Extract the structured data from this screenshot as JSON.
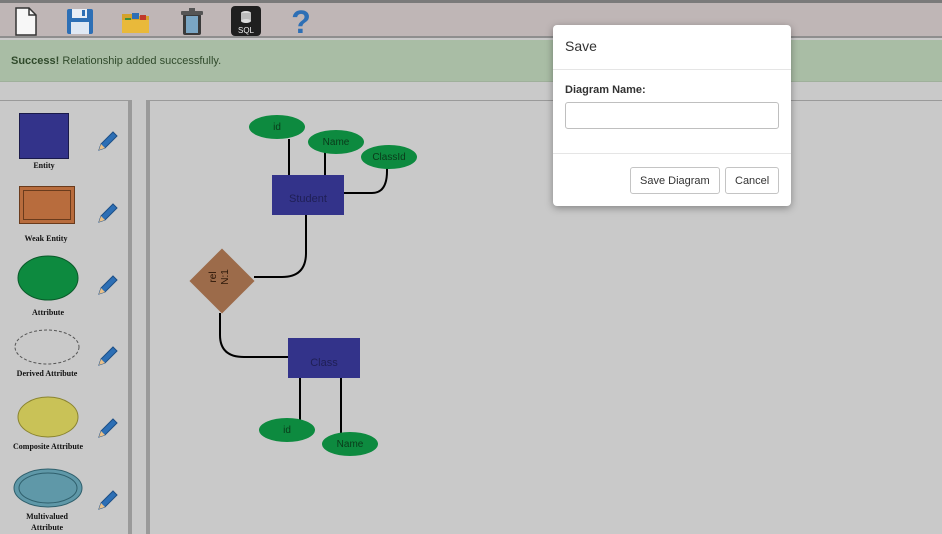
{
  "toolbar": {
    "items": [
      {
        "icon": "new-file-icon"
      },
      {
        "icon": "save-icon"
      },
      {
        "icon": "open-folder-icon"
      },
      {
        "icon": "trash-icon"
      },
      {
        "icon": "sql-icon",
        "label": "SQL"
      },
      {
        "icon": "help-icon",
        "label": "?"
      }
    ]
  },
  "alert": {
    "strong": "Success!",
    "message": " Relationship added successfully."
  },
  "palette": {
    "items": [
      {
        "label": "Entity"
      },
      {
        "label": "Weak Entity"
      },
      {
        "label": "Attribute"
      },
      {
        "label": "Derived Attribute"
      },
      {
        "label": "Composite Attribute"
      },
      {
        "label": "Multivalued Attribute"
      }
    ]
  },
  "diagram": {
    "entities": [
      {
        "name": "Student"
      },
      {
        "name": "Class"
      }
    ],
    "attributes": [
      {
        "name": "id"
      },
      {
        "name": "Name"
      },
      {
        "name": "ClassId"
      },
      {
        "name": "id"
      },
      {
        "name": "Name"
      }
    ],
    "relationship": {
      "name": "rel",
      "cardinality": "N:1"
    }
  },
  "modal": {
    "title": "Save",
    "field_label": "Diagram Name:",
    "field_value": "",
    "field_placeholder": "",
    "save_label": "Save Diagram",
    "cancel_label": "Cancel"
  },
  "colors": {
    "entity": "#33338a",
    "attribute": "#0d8a3f",
    "relationship": "#9c6b4a",
    "alert_bg": "#a9bda5",
    "canvas_bg": "#c9c9c9"
  }
}
